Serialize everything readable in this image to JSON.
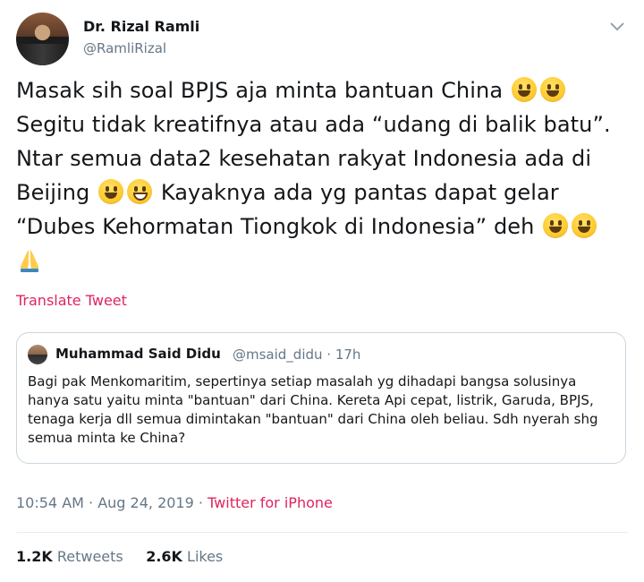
{
  "author": {
    "name": "Dr. Rizal Ramli",
    "handle": "@RamliRizal"
  },
  "tweet": {
    "line1": "Masak sih soal BPJS aja minta bantuan China ",
    "line2": "Segitu tidak kreatifnya atau ada “udang di balik batu”.",
    "line3": "Ntar semua data2 kesehatan rakyat Indonesia ada di",
    "line4a": "Beijing ",
    "line4b": " Kayaknya ada yg pantas dapat gelar",
    "line5": "“Dubes Kehormatan Tiongkok di Indonesia” deh "
  },
  "translate_label": "Translate Tweet",
  "quoted": {
    "name": "Muhammad Said Didu",
    "handle": "@msaid_didu · 17h",
    "text": "Bagi pak Menkomaritim, sepertinya setiap masalah yg dihadapi bangsa solusinya hanya satu yaitu minta \"bantuan\" dari China. Kereta Api cepat, listrik, Garuda, BPJS, tenaga kerja dll semua dimintakan \"bantuan\" dari China oleh beliau. Sdh nyerah shg semua minta ke China?"
  },
  "meta": {
    "time": "10:54 AM · Aug 24, 2019 · ",
    "source": "Twitter for iPhone"
  },
  "stats": {
    "retweets_count": "1.2K",
    "retweets_label": "Retweets",
    "likes_count": "2.6K",
    "likes_label": "Likes"
  },
  "colors": {
    "accent": "#e0245e",
    "muted": "#657786",
    "border": "#ccd6dd"
  },
  "icons": {
    "caret": "chevron-down-icon",
    "emoji": "smiley-emoji",
    "pray": "folded-hands-emoji"
  }
}
